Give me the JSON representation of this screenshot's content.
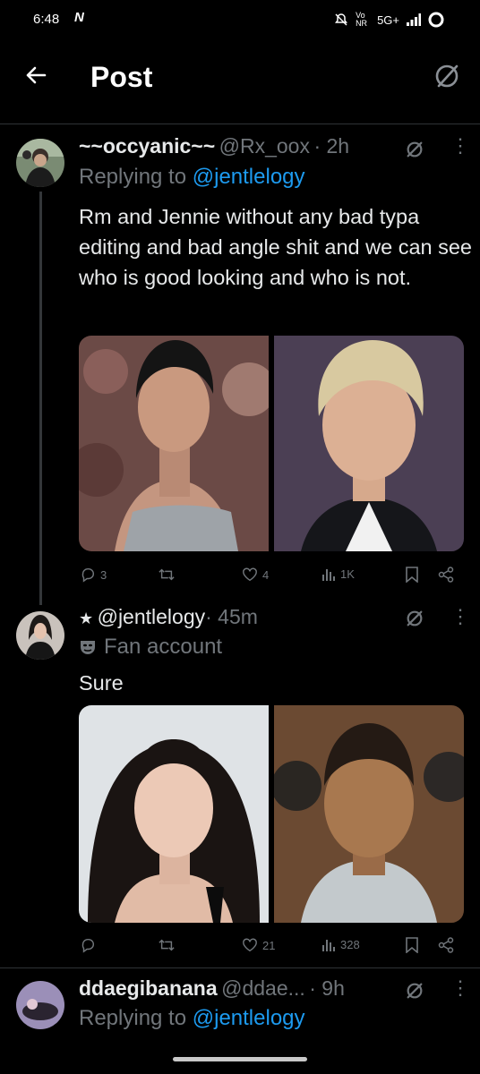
{
  "status": {
    "time": "6:48",
    "network": "5G+",
    "vo": "Vo NR"
  },
  "header": {
    "title": "Post"
  },
  "tweets": [
    {
      "name": "~~occyanic~~",
      "handle": "@Rx_oox",
      "time": "· 2h",
      "reply_prefix": "Replying to ",
      "reply_to": "@jentlelogy",
      "text": "Rm and Jennie without any bad typa editing and bad angle shit and we can see who is good looking and who is not.",
      "stats": {
        "replies": "3",
        "likes": "4",
        "views": "1K"
      }
    },
    {
      "prefix": "★",
      "handle": "@jentlelogy",
      "time": "· 45m",
      "label": "Fan account",
      "text": "Sure",
      "stats": {
        "replies": "",
        "likes": "21",
        "views": "328"
      }
    },
    {
      "name": "ddaegibanana",
      "handle": "@ddae...",
      "time": "· 9h",
      "reply_prefix": "Replying to ",
      "reply_to": "@jentlelogy"
    }
  ],
  "colors": {
    "accent": "#1d9bf0",
    "muted": "#71767b",
    "text": "#e7e9ea",
    "bg": "#000000"
  }
}
